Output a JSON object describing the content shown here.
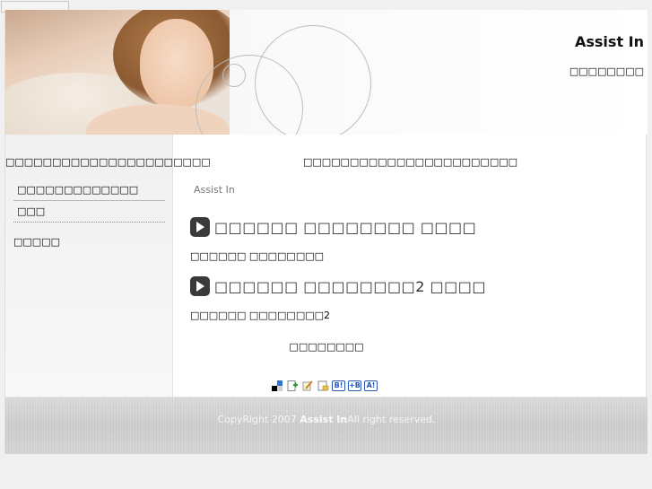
{
  "header": {
    "site_title": "Assist In",
    "site_subtitle": "□□□□□□□□"
  },
  "sidebar": {
    "title": "□□□□□□□□□□□□□□□□□□□□□□",
    "items": [
      {
        "label": "□□□□□□□□□□□□□"
      },
      {
        "label": "□□□"
      }
    ],
    "extra": "□□□□□"
  },
  "main": {
    "title": "□□□□□□□□□□□□□□□□□□□□□□□",
    "breadcrumb": "Assist In",
    "posts": [
      {
        "title": "□□□□□□ □□□□□□□□ □□□□",
        "body": "□□□□□□ □□□□□□□□"
      },
      {
        "title": "□□□□□□ □□□□□□□□2 □□□□",
        "body": "□□□□□□ □□□□□□□□2"
      }
    ],
    "more_link": "□□□□□□□□"
  },
  "share": {
    "buttons": [
      "delicious-icon",
      "add-bookmark-icon",
      "edit-bookmark-icon",
      "folder-bookmark-icon",
      "B!",
      "+B",
      "A!"
    ]
  },
  "footer": {
    "copyright_prefix": "CopyRight 2007 ",
    "copyright_name": "Assist In",
    "copyright_suffix": "All right reserved."
  },
  "colors": {
    "page_bg": "#f0f0f0",
    "content_bg": "#ffffff",
    "play_icon_bg": "#3a3a3a",
    "footer_bg": "#d4d4d4",
    "badge_blue": "#2a56b8"
  }
}
